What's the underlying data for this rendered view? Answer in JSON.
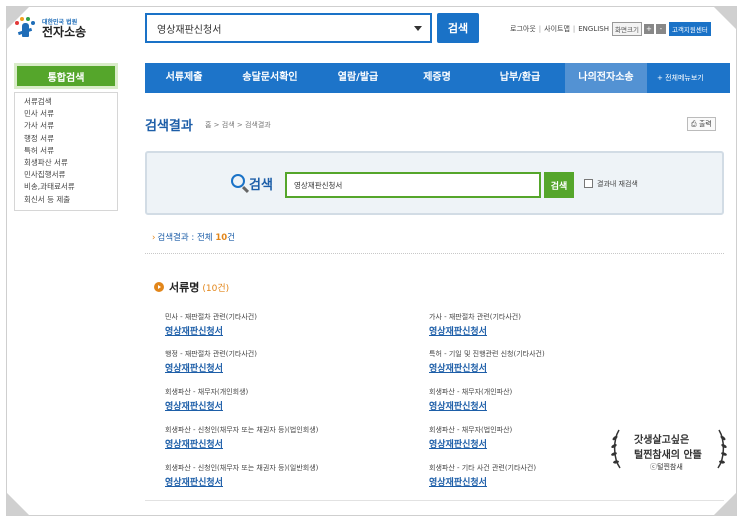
{
  "logo": {
    "small": "대한민국 법원",
    "big": "전자소송"
  },
  "top_search": {
    "value": "영상재판신청서",
    "button": "검색"
  },
  "util": {
    "logout": "로그아웃",
    "sitemap": "사이트맵",
    "english": "ENGLISH",
    "zoom": "화면크기",
    "zoom_in": "+",
    "zoom_out": "-",
    "help_center": "고객지원센터"
  },
  "side": {
    "title": "통합검색",
    "items": [
      "서류검색",
      "민사 서류",
      "가사 서류",
      "행정 서류",
      "특허 서류",
      "회생파산 서류",
      "민사집행서류",
      "비송,과태료서류",
      "회신서 등 제출"
    ]
  },
  "nav": {
    "items": [
      "서류제출",
      "송달문서확인",
      "열람/발급",
      "제증명",
      "납부/환급",
      "나의전자소송"
    ],
    "all": "+ 전체메뉴보기"
  },
  "crumb": {
    "title": "검색결과",
    "path": "홈 > 검색 > 검색결과",
    "print": "출력"
  },
  "panel": {
    "label": "검색",
    "value": "영상재판신청서",
    "button": "검색",
    "check_label": "결과내 재검색"
  },
  "summary": {
    "prefix": "검색결과 : 전체",
    "count": "10",
    "suffix": "건"
  },
  "section": {
    "title": "서류명",
    "count": "(10건)"
  },
  "results": [
    {
      "category": "민사 - 재판절차 관련(기타사건)",
      "name": "영상재판신청서"
    },
    {
      "category": "가사 - 재판절차 관련(기타사건)",
      "name": "영상재판신청서"
    },
    {
      "category": "행정 - 재판절차 관련(기타사건)",
      "name": "영상재판신청서"
    },
    {
      "category": "특허 - 기일 및 진행관련 신청(기타사건)",
      "name": "영상재판신청서"
    },
    {
      "category": "회생파산 - 채무자(개인회생)",
      "name": "영상재판신청서"
    },
    {
      "category": "회생파산 - 채무자(개인파산)",
      "name": "영상재판신청서"
    },
    {
      "category": "회생파산 - 신청인(채무자 또는 채권자 등)(법인회생)",
      "name": "영상재판신청서"
    },
    {
      "category": "회생파산 - 채무자(법인파산)",
      "name": "영상재판신청서"
    },
    {
      "category": "회생파산 - 신청인(채무자 또는 채권자 등)(일반회생)",
      "name": "영상재판신청서"
    },
    {
      "category": "회생파산 - 기타 사건 관련(기타사건)",
      "name": "영상재판신청서"
    }
  ],
  "watermark": {
    "line1": "갓생살고싶은",
    "line2": "털찐참새의 안뜰",
    "line3": "ⓒ털찐참새"
  },
  "colors": {
    "primary": "#1d74c9",
    "green": "#55a62b",
    "accent": "#e2861a"
  }
}
